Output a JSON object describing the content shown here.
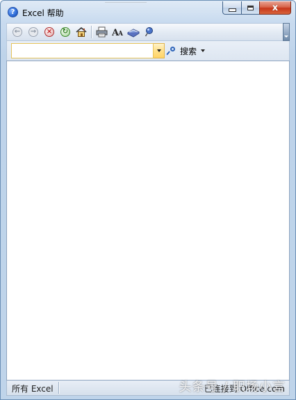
{
  "window": {
    "title": "Excel 帮助",
    "title_icon": "help-icon",
    "accent_color": "#2d6bd6",
    "caption": {
      "minimize_icon": "minimize-icon",
      "maximize_icon": "maximize-icon",
      "close_icon": "close-icon",
      "close_glyph": "x"
    }
  },
  "toolbar": {
    "buttons": [
      {
        "icon": "back-icon",
        "glyph": "←",
        "enabled": false
      },
      {
        "icon": "forward-icon",
        "glyph": "→",
        "enabled": false
      },
      {
        "icon": "stop-icon",
        "glyph": "×",
        "enabled": true
      },
      {
        "icon": "refresh-icon",
        "glyph": "↻",
        "enabled": true
      },
      {
        "icon": "home-icon",
        "glyph": "⌂",
        "enabled": true
      },
      {
        "icon": "print-icon",
        "glyph": "🖶",
        "enabled": true
      },
      {
        "icon": "font-size-icon",
        "glyph": "Aᴬ",
        "enabled": true
      },
      {
        "icon": "table-of-contents-icon",
        "glyph": "📘",
        "enabled": true
      },
      {
        "icon": "keep-on-top-icon",
        "glyph": "📌",
        "enabled": true
      }
    ]
  },
  "search": {
    "input_value": "",
    "placeholder": "",
    "button_label": "搜索",
    "dropdown_icon": "chevron-down-icon"
  },
  "content": {
    "body": ""
  },
  "status": {
    "scope": "所有 Excel",
    "connection": "已连接到 Office.com",
    "watermark": "头条号 / 职场小言"
  }
}
